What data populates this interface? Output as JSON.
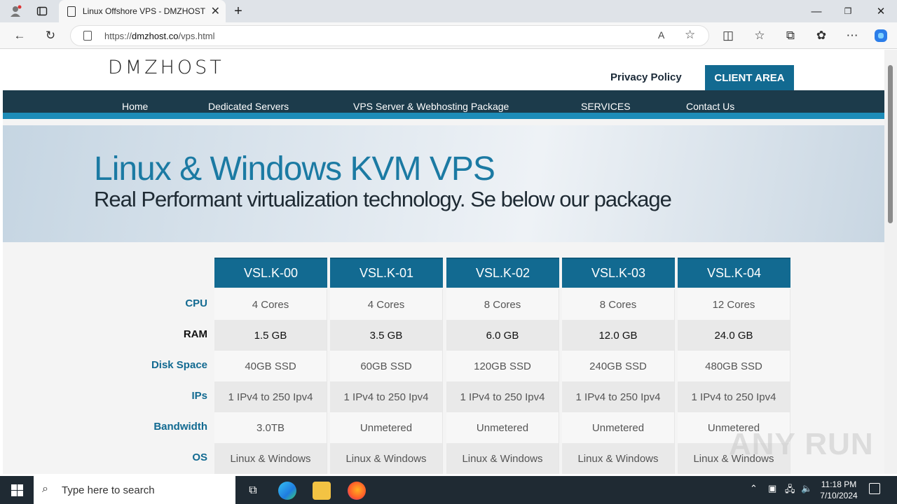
{
  "browser": {
    "tab_title": "Linux Offshore VPS - DMZHOST",
    "url_prefix": "https://",
    "url_domain": "dmzhost.co",
    "url_path": "/vps.html"
  },
  "site": {
    "logo": "DMZHOST",
    "privacy": "Privacy Policy",
    "client_area": "CLIENT AREA",
    "nav": [
      "Home",
      "Dedicated Servers",
      "VPS Server & Webhosting Package",
      "SERVICES",
      "Contact Us"
    ],
    "hero_title": "Linux & Windows KVM VPS",
    "hero_sub": "Real Performant virtualization technology. Se below our package"
  },
  "pricing": {
    "plans": [
      "VSL.K-00",
      "VSL.K-01",
      "VSL.K-02",
      "VSL.K-03",
      "VSL.K-04"
    ],
    "rows": [
      {
        "label": "CPU",
        "values": [
          "4 Cores",
          "4 Cores",
          "8 Cores",
          "8 Cores",
          "12 Cores"
        ]
      },
      {
        "label": "RAM",
        "values": [
          "1.5 GB",
          "3.5 GB",
          "6.0 GB",
          "12.0 GB",
          "24.0 GB"
        ]
      },
      {
        "label": "Disk Space",
        "values": [
          "40GB SSD",
          "60GB SSD",
          "120GB SSD",
          "240GB SSD",
          "480GB SSD"
        ]
      },
      {
        "label": "IPs",
        "values": [
          "1 IPv4 to 250 Ipv4",
          "1 IPv4 to 250 Ipv4",
          "1 IPv4 to 250 Ipv4",
          "1 IPv4 to 250 Ipv4",
          "1 IPv4 to 250 Ipv4"
        ]
      },
      {
        "label": "Bandwidth",
        "values": [
          "3.0TB",
          "Unmetered",
          "Unmetered",
          "Unmetered",
          "Unmetered"
        ]
      },
      {
        "label": "OS",
        "values": [
          "Linux & Windows",
          "Linux & Windows",
          "Linux & Windows",
          "Linux & Windows",
          "Linux & Windows"
        ]
      }
    ]
  },
  "taskbar": {
    "search_placeholder": "Type here to search",
    "time": "11:18 PM",
    "date": "7/10/2024"
  },
  "watermark": "ANY RUN"
}
